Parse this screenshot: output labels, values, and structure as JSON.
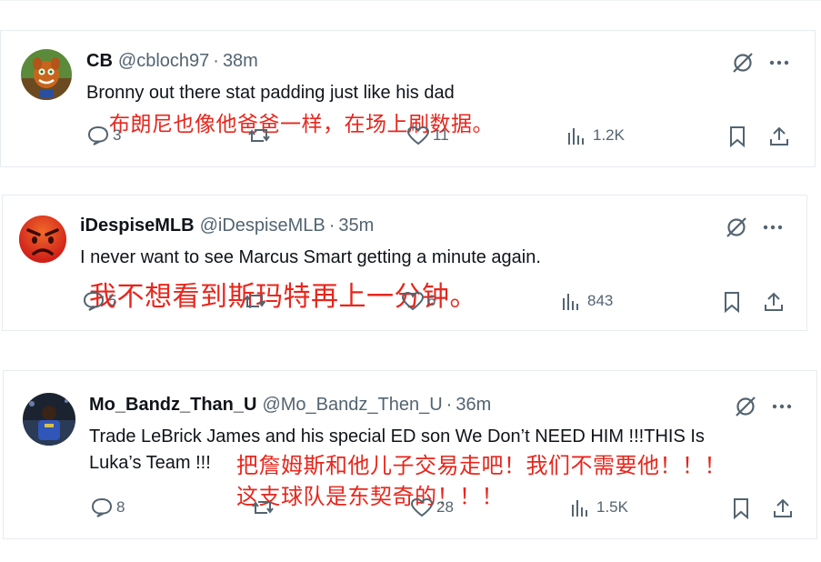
{
  "tweets": [
    {
      "name": "CB",
      "handle": "@cbloch97",
      "sep": "·",
      "time": "38m",
      "text": "Bronny out there stat padding just like his dad",
      "translation": "布朗尼也像他爸爸一样，在场上刷数据。",
      "translation_lines": [
        "布朗尼也像他爸爸一样，在场上刷数据。"
      ],
      "replies": "3",
      "reposts": "",
      "likes": "11",
      "views": "1.2K"
    },
    {
      "name": "iDespiseMLB",
      "handle": "@iDespiseMLB",
      "sep": "·",
      "time": "35m",
      "text": "I never want to see Marcus Smart getting a minute again.",
      "translation": "我不想看到斯玛特再上一分钟。",
      "translation_lines": [
        "我不想看到斯玛特再上一分钟。"
      ],
      "replies": "5",
      "reposts": "",
      "likes": "6",
      "views": "843"
    },
    {
      "name": "Mo_Bandz_Than_U",
      "handle": "@Mo_Bandz_Then_U",
      "sep": "·",
      "time": "36m",
      "text_lines": [
        "Trade LeBrick James and his special ED son We Don’t NEED HIM !!!THIS Is",
        "Luka’s Team !!!"
      ],
      "translation_lines": [
        "把詹姆斯和他儿子交易走吧！我们不需要他！！！",
        "这支球队是东契奇的！！！"
      ],
      "replies": "8",
      "reposts": "",
      "likes": "28",
      "views": "1.5K"
    }
  ],
  "icons": {
    "reply": "speech-bubble-icon",
    "repost": "repost-arrows-icon",
    "like": "heart-icon",
    "views": "bar-chart-icon",
    "bookmark": "bookmark-icon",
    "share": "share-upload-icon",
    "grok": "slashed-circle-icon",
    "more": "ellipsis-icon"
  },
  "colors": {
    "translation_red": "#e8261c",
    "muted_gray": "#536471",
    "text_black": "#0f1419"
  }
}
